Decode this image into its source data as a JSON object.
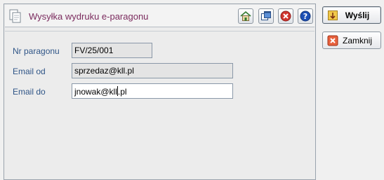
{
  "header": {
    "title": "Wysyłka wydruku e-paragonu",
    "icons": [
      "home-icon",
      "windows-icon",
      "close-circle-icon",
      "help-icon"
    ]
  },
  "form": {
    "receipt_number": {
      "label": "Nr paragonu",
      "value": "FV/25/001"
    },
    "email_from": {
      "label": "Email od",
      "value": "sprzedaz@kll.pl"
    },
    "email_to": {
      "label": "Email do",
      "value_before_caret": "jnowak@kll",
      "value_after_caret": ".pl"
    }
  },
  "actions": {
    "send_label": "Wyślij",
    "close_label": "Zamknij"
  },
  "colors": {
    "title": "#7b2b5e",
    "label": "#2f5587",
    "help": "#1d4fb5",
    "close": "#d0352f"
  }
}
